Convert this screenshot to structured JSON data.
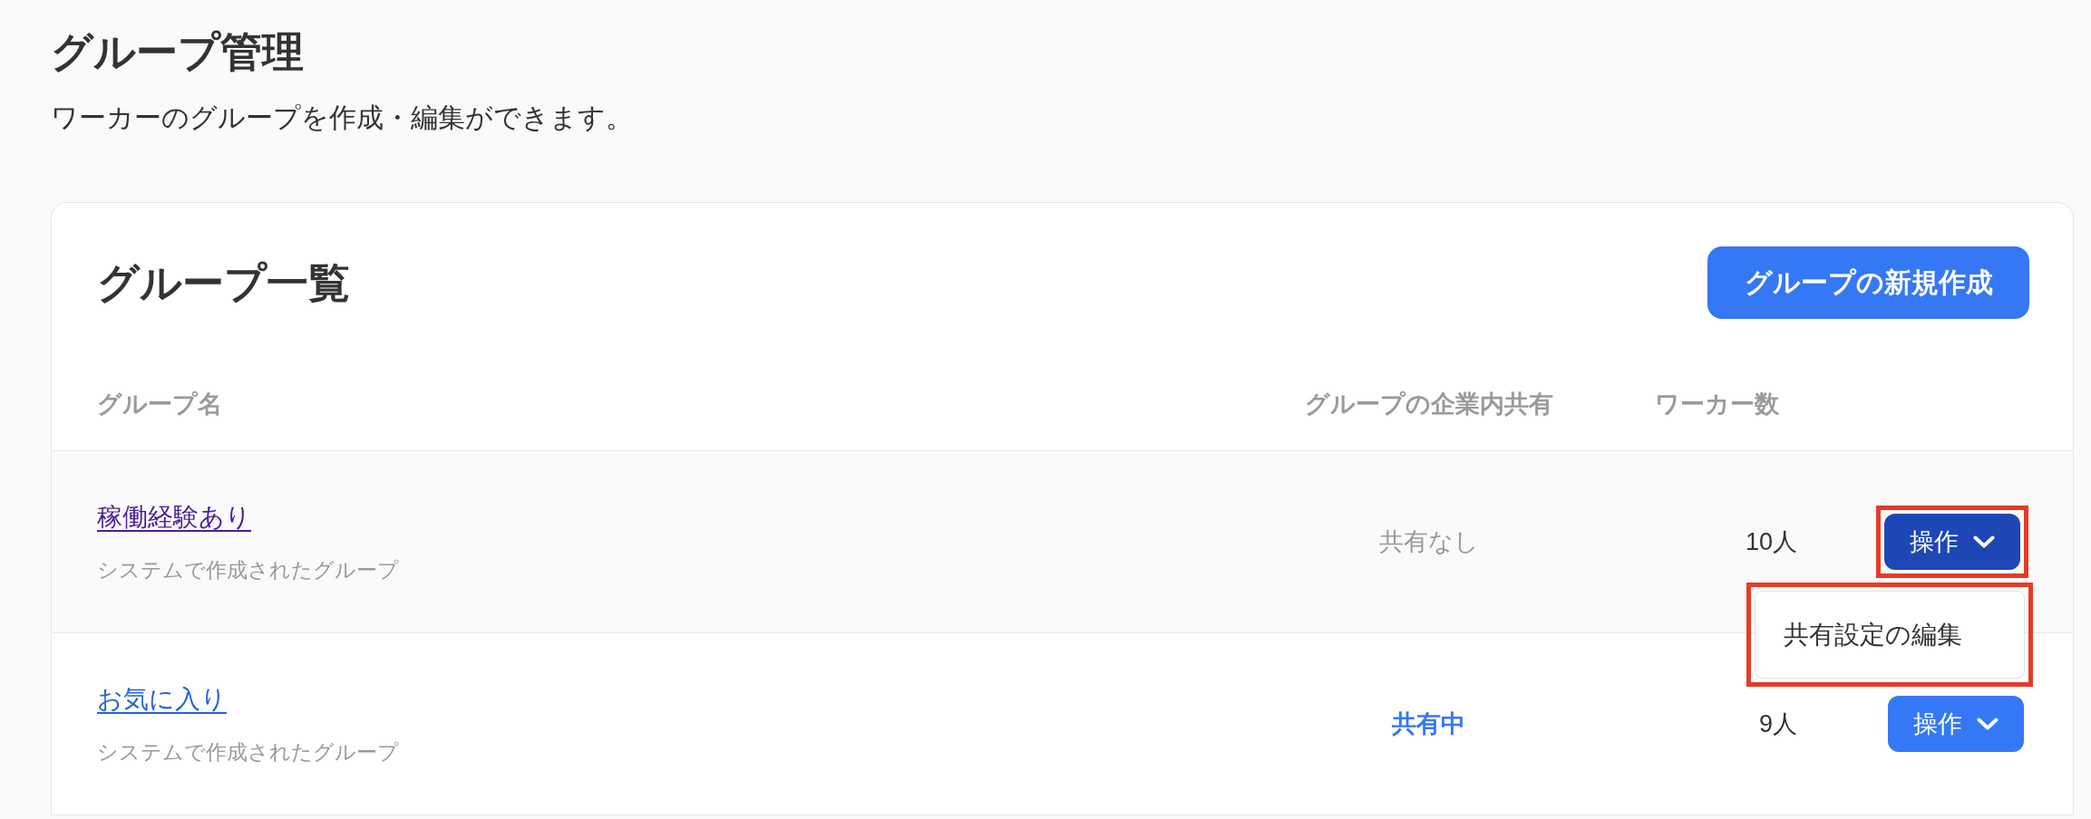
{
  "page": {
    "title": "グループ管理",
    "description": "ワーカーのグループを作成・編集ができます。"
  },
  "card": {
    "title": "グループ一覧",
    "new_button": "グループの新規作成"
  },
  "table": {
    "columns": [
      "グループ名",
      "グループの企業内共有",
      "ワーカー数"
    ],
    "rows": [
      {
        "name": "稼働経験あり",
        "visited": true,
        "note": "システムで作成されたグループ",
        "sharing": "共有なし",
        "shared": false,
        "workers": "10人",
        "action": {
          "label": "操作",
          "expanded": true,
          "annotated": true
        },
        "menu": {
          "annotated": true,
          "items": [
            {
              "label": "共有設定の編集"
            }
          ]
        }
      },
      {
        "name": "お気に入り",
        "visited": false,
        "note": "システムで作成されたグループ",
        "sharing": "共有中",
        "shared": true,
        "workers": "9人",
        "action": {
          "label": "操作",
          "expanded": false,
          "annotated": false
        }
      }
    ]
  }
}
